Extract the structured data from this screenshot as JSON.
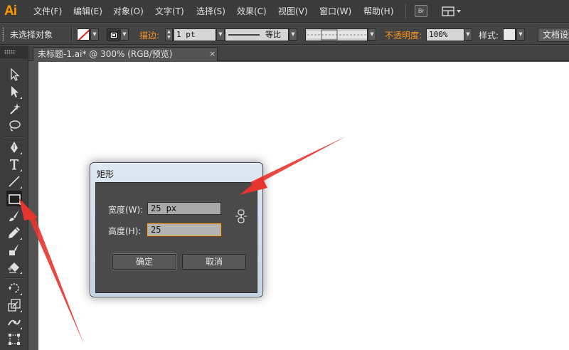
{
  "app": {
    "logo": "Ai"
  },
  "menu": {
    "items": [
      {
        "label": "文件(F)"
      },
      {
        "label": "编辑(E)"
      },
      {
        "label": "对象(O)"
      },
      {
        "label": "文字(T)"
      },
      {
        "label": "选择(S)"
      },
      {
        "label": "效果(C)"
      },
      {
        "label": "视图(V)"
      },
      {
        "label": "窗口(W)"
      },
      {
        "label": "帮助(H)"
      }
    ],
    "bridge_label": "Br"
  },
  "control_bar": {
    "selection_label": "未选择对象",
    "stroke_label": "描边:",
    "stroke_weight": "1 pt",
    "stroke_profile_label": "等比",
    "opacity_label": "不透明度:",
    "opacity_value": "100%",
    "style_label": "样式:",
    "doc_settings_label": "文档设置"
  },
  "document": {
    "tab_title": "未标题-1.ai* @ 300% (RGB/预览)",
    "close_glyph": "×"
  },
  "toolbar": {
    "active_tool": "rectangle-tool"
  },
  "dialog": {
    "title": "矩形",
    "width_label": "宽度(W):",
    "width_value": "25 px",
    "height_label": "高度(H):",
    "height_value": "25",
    "ok_label": "确定",
    "cancel_label": "取消"
  },
  "colors": {
    "accent_orange": "#f7931e",
    "logo_orange": "#ff9a00",
    "annotation_red": "#e8342e",
    "focus_outline": "#e8a33a"
  }
}
